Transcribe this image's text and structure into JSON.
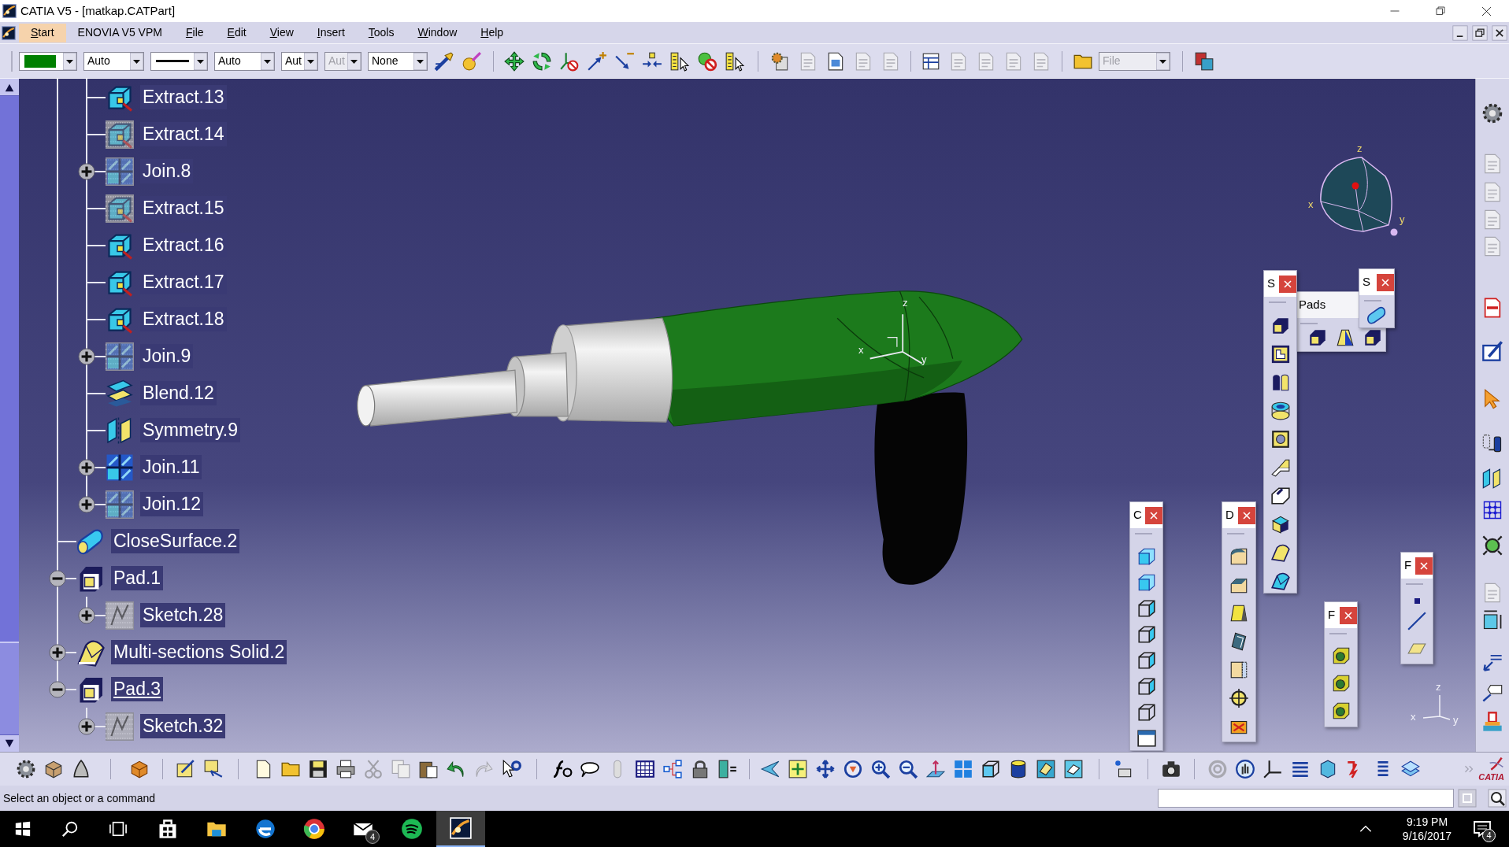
{
  "window": {
    "title": "CATIA V5 - [matkap.CATPart]"
  },
  "menu_bar": {
    "items": [
      {
        "label": "Start",
        "selected": true,
        "mnemonic": true
      },
      {
        "label": "ENOVIA V5 VPM",
        "selected": false,
        "mnemonic": false
      },
      {
        "label": "File",
        "selected": false,
        "mnemonic": true
      },
      {
        "label": "Edit",
        "selected": false,
        "mnemonic": true
      },
      {
        "label": "View",
        "selected": false,
        "mnemonic": true
      },
      {
        "label": "Insert",
        "selected": false,
        "mnemonic": true
      },
      {
        "label": "Tools",
        "selected": false,
        "mnemonic": true
      },
      {
        "label": "Window",
        "selected": false,
        "mnemonic": true
      },
      {
        "label": "Help",
        "selected": false,
        "mnemonic": true
      }
    ]
  },
  "toolbar": {
    "fields": [
      {
        "kind": "color",
        "color": "#008000",
        "disabled": false
      },
      {
        "kind": "select",
        "value": "Auto",
        "disabled": false
      },
      {
        "kind": "line",
        "disabled": false
      },
      {
        "kind": "select",
        "value": "Auto",
        "disabled": false
      },
      {
        "kind": "select",
        "value": "Aut",
        "disabled": false
      },
      {
        "kind": "select",
        "value": "Aut",
        "disabled": true
      },
      {
        "kind": "select",
        "value": "None",
        "disabled": false
      }
    ],
    "file_field": {
      "value": "File",
      "disabled": true
    }
  },
  "tree": [
    {
      "children": [
        {
          "label": "Extract.13",
          "kind": "extract",
          "hidden": false,
          "collapsed": false,
          "in_work": false
        },
        {
          "label": "Extract.14",
          "kind": "extract",
          "hidden": true,
          "collapsed": false,
          "in_work": false
        },
        {
          "label": "Join.8",
          "kind": "join",
          "hidden": true,
          "collapsed": true,
          "in_work": false
        },
        {
          "label": "Extract.15",
          "kind": "extract",
          "hidden": true,
          "collapsed": false,
          "in_work": false
        },
        {
          "label": "Extract.16",
          "kind": "extract",
          "hidden": false,
          "collapsed": false,
          "in_work": false
        },
        {
          "label": "Extract.17",
          "kind": "extract",
          "hidden": false,
          "collapsed": false,
          "in_work": false
        },
        {
          "label": "Extract.18",
          "kind": "extract",
          "hidden": false,
          "collapsed": false,
          "in_work": false
        },
        {
          "label": "Join.9",
          "kind": "join",
          "hidden": true,
          "collapsed": true,
          "in_work": false
        },
        {
          "label": "Blend.12",
          "kind": "blend",
          "hidden": false,
          "collapsed": false,
          "in_work": false
        },
        {
          "label": "Symmetry.9",
          "kind": "symmetry",
          "hidden": false,
          "collapsed": false,
          "in_work": false
        },
        {
          "label": "Join.11",
          "kind": "join",
          "hidden": false,
          "collapsed": true,
          "in_work": false
        },
        {
          "label": "Join.12",
          "kind": "join",
          "hidden": true,
          "collapsed": true,
          "in_work": false
        }
      ]
    },
    {
      "label": "CloseSurface.2",
      "kind": "close_surface",
      "hidden": false,
      "collapsed": false,
      "in_work": false
    },
    {
      "label": "Pad.1",
      "kind": "pad",
      "hidden": false,
      "collapsed": false,
      "in_work": false,
      "children": [
        {
          "label": "Sketch.28",
          "kind": "sketch",
          "hidden": true,
          "collapsed": true,
          "in_work": false
        }
      ]
    },
    {
      "label": "Multi-sections Solid.2",
      "kind": "multi_sections",
      "hidden": false,
      "collapsed": true,
      "in_work": false
    },
    {
      "label": "Pad.3",
      "kind": "pad",
      "hidden": false,
      "collapsed": false,
      "in_work": true,
      "children": [
        {
          "label": "Sketch.32",
          "kind": "sketch",
          "hidden": true,
          "collapsed": true,
          "in_work": false
        }
      ]
    }
  ],
  "viewport": {
    "compass_labels": [
      "z",
      "x",
      "y"
    ],
    "model_axis_labels": [
      "z",
      "x",
      "y"
    ],
    "corner_axis_labels": [
      "z",
      "x",
      "y"
    ]
  },
  "floating_toolbars": [
    {
      "title": "S"
    },
    {
      "title": "Pads"
    },
    {
      "title": "S"
    },
    {
      "title": "C"
    },
    {
      "title": "D"
    },
    {
      "title": "F"
    },
    {
      "title": "F"
    }
  ],
  "bottom_toolbar": {
    "logo_text": "CATIA"
  },
  "status_bar": {
    "message": "Select an object or a command"
  },
  "taskbar": {
    "apps": [
      {
        "kind": "store",
        "selected": false
      },
      {
        "kind": "folder",
        "selected": false
      },
      {
        "kind": "browser_swirl",
        "selected": false
      },
      {
        "kind": "browser_round",
        "selected": false
      },
      {
        "kind": "mail",
        "selected": false,
        "badge": "4"
      },
      {
        "kind": "music",
        "selected": false
      },
      {
        "kind": "cad",
        "selected": true
      }
    ],
    "time": "9:19 PM",
    "date": "9/16/2017",
    "notification_count": "4"
  }
}
